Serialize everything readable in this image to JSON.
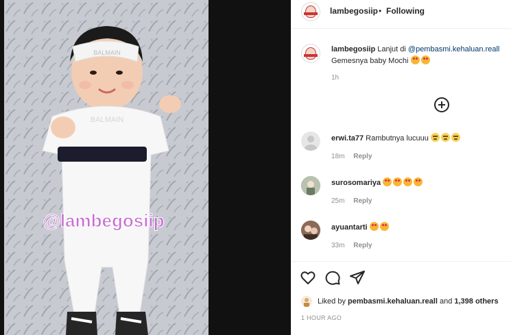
{
  "media": {
    "watermark": "@lambegosiip",
    "headband_text": "BALMAIN",
    "onesie_text": "BALMAIN"
  },
  "header": {
    "username": "lambegosiip",
    "separator": "•",
    "follow_status": "Following"
  },
  "caption": {
    "username": "lambegosiip",
    "text_prefix": "Lanjut di",
    "mention": "@pembasmi.kehaluan.reall",
    "line2": "Gemesnya baby Mochi",
    "time": "1h"
  },
  "comments": [
    {
      "username": "erwi.ta77",
      "text": "Rambutnya lucuuu",
      "emojis": [
        "sweat",
        "sweat",
        "sweat"
      ],
      "time": "18m",
      "reply_label": "Reply"
    },
    {
      "username": "surosomariya",
      "text": "",
      "emojis": [
        "heart",
        "heart",
        "heart",
        "heart"
      ],
      "time": "25m",
      "reply_label": "Reply"
    },
    {
      "username": "ayuantarti",
      "text": "",
      "emojis": [
        "heart",
        "heart"
      ],
      "time": "33m",
      "reply_label": "Reply"
    }
  ],
  "likes": {
    "prefix": "Liked by",
    "user": "pembasmi.kehaluan.reall",
    "and": "and",
    "others": "1,398 others"
  },
  "post_time": "1 HOUR AGO",
  "icons": [
    "heart-outline-icon",
    "comment-icon",
    "share-icon",
    "add-comment-icon"
  ]
}
